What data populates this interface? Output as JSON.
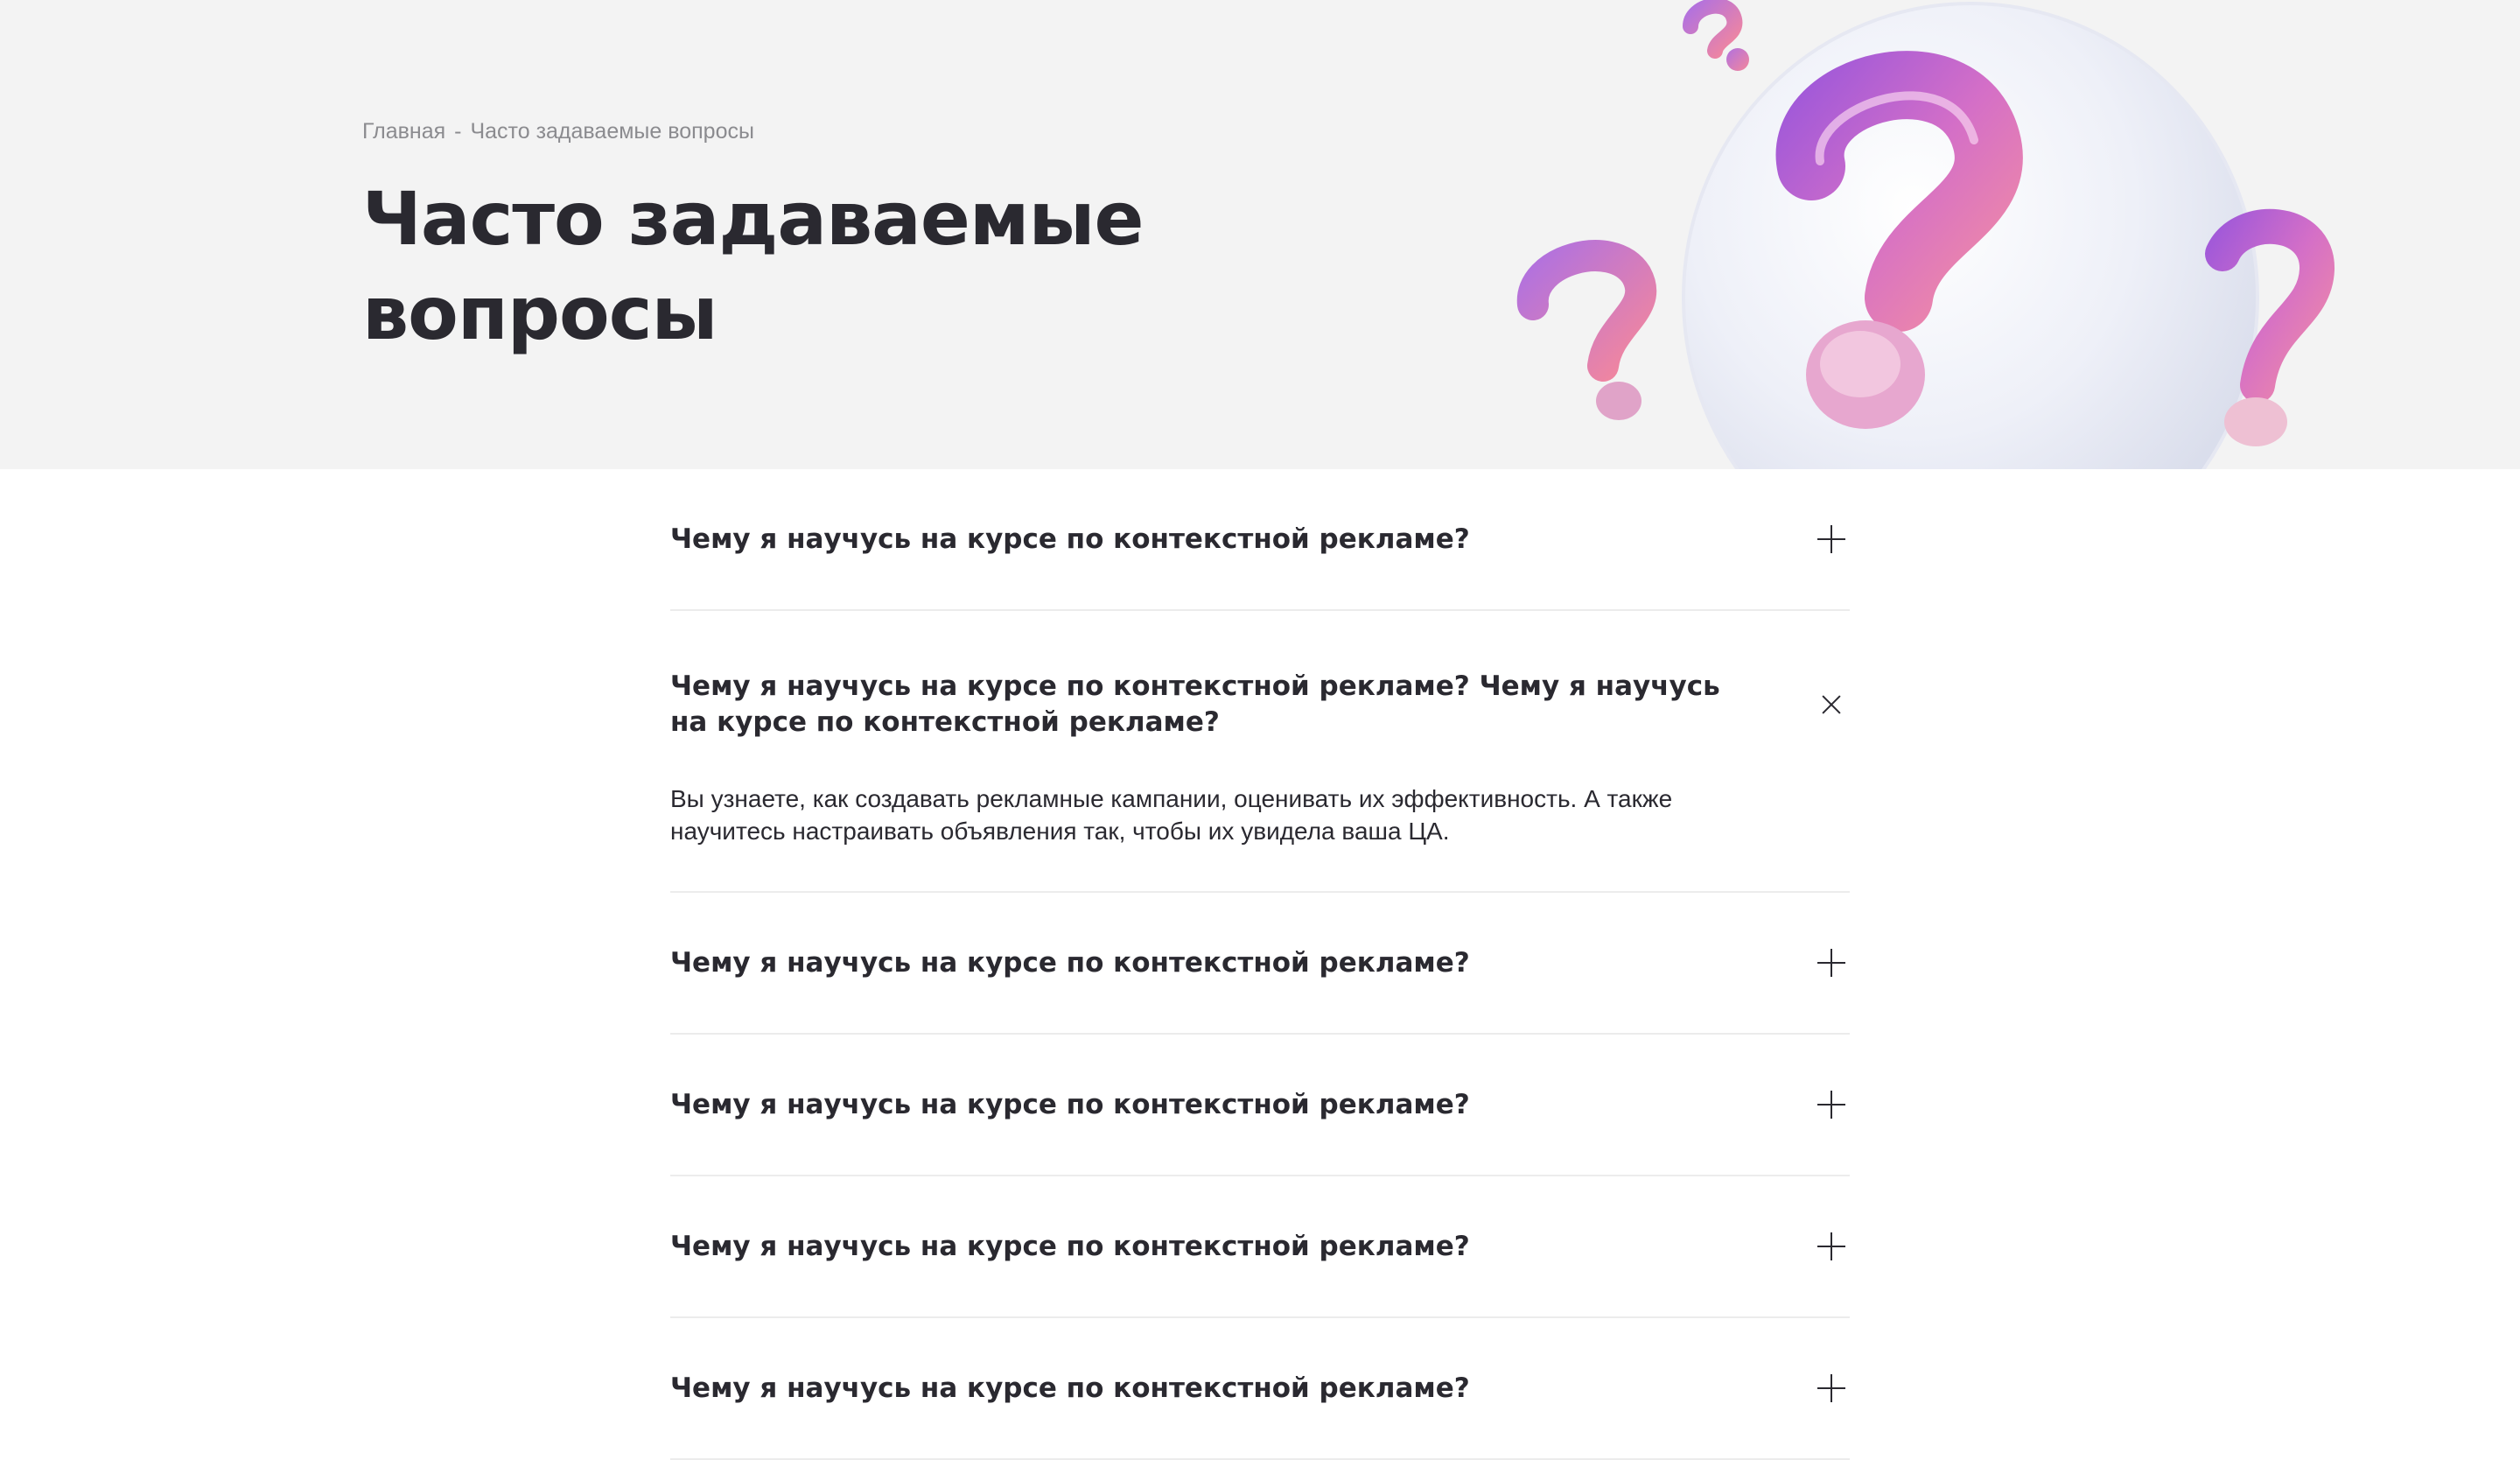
{
  "breadcrumb": {
    "home": "Главная",
    "separator": "-",
    "current": "Часто задаваемые вопросы"
  },
  "hero": {
    "title_line1": "Часто задаваемые",
    "title_line2": "вопросы",
    "illustration": "question-marks-sphere"
  },
  "faq": {
    "items": [
      {
        "question": "Чему я научусь на курсе по контекстной рекламе?",
        "expanded": false,
        "icon": "plus-icon"
      },
      {
        "question": "Чему я научусь на курсе по контекстной рекламе? Чему я научусь на курсе по контекстной рекламе?",
        "answer": "Вы узнаете, как создавать рекламные кампании, оценивать их эффективность. А также научитесь настраивать объявления так, чтобы их увидела ваша ЦА.",
        "expanded": true,
        "icon": "close-icon"
      },
      {
        "question": "Чему я научусь на курсе по контекстной рекламе?",
        "expanded": false,
        "icon": "plus-icon"
      },
      {
        "question": "Чему я научусь на курсе по контекстной рекламе?",
        "expanded": false,
        "icon": "plus-icon"
      },
      {
        "question": "Чему я научусь на курсе по контекстной рекламе?",
        "expanded": false,
        "icon": "plus-icon"
      },
      {
        "question": "Чему я научусь на курсе по контекстной рекламе?",
        "expanded": false,
        "icon": "plus-icon"
      }
    ]
  },
  "colors": {
    "hero_bg": "#f3f3f3",
    "text": "#2a2930",
    "muted": "#8b8b8f",
    "divider": "#ececec",
    "accent_purple": "#a35ad8",
    "accent_pink": "#ec6aa3"
  }
}
